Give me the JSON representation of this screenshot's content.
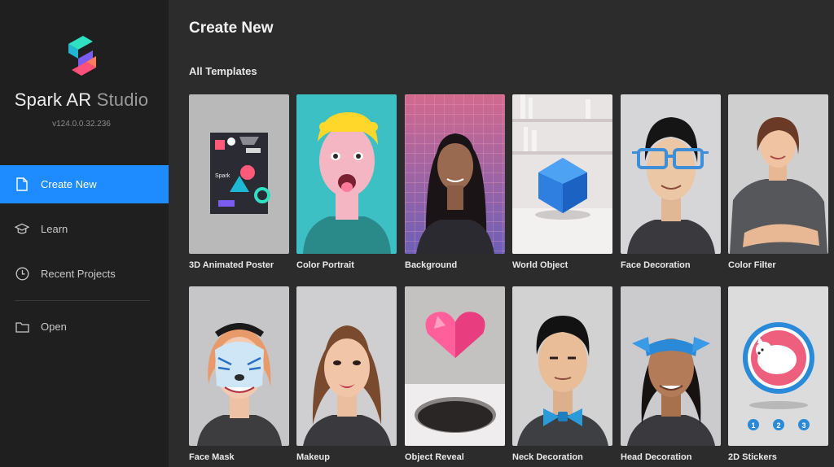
{
  "app": {
    "name_main": "Spark AR",
    "name_sub": "Studio",
    "version": "v124.0.0.32.236"
  },
  "sidebar": {
    "items": [
      {
        "label": "Create New",
        "icon": "file-icon",
        "active": true
      },
      {
        "label": "Learn",
        "icon": "graduation-cap-icon",
        "active": false
      },
      {
        "label": "Recent Projects",
        "icon": "clock-icon",
        "active": false
      },
      {
        "label": "Open",
        "icon": "folder-icon",
        "active": false
      }
    ]
  },
  "main": {
    "title": "Create New",
    "section_title": "All Templates",
    "templates": [
      {
        "label": "3D Animated Poster"
      },
      {
        "label": "Color Portrait"
      },
      {
        "label": "Background"
      },
      {
        "label": "World Object"
      },
      {
        "label": "Face Decoration"
      },
      {
        "label": "Color Filter"
      },
      {
        "label": "Face Mask"
      },
      {
        "label": "Makeup"
      },
      {
        "label": "Object Reveal"
      },
      {
        "label": "Neck Decoration"
      },
      {
        "label": "Head Decoration"
      },
      {
        "label": "2D Stickers"
      }
    ],
    "poster_text": "Spark",
    "sticker_steps": [
      "1",
      "2",
      "3"
    ]
  },
  "colors": {
    "accent": "#1e8cff",
    "sidebar_bg": "#1f1f1f",
    "main_bg": "#2c2c2c"
  }
}
